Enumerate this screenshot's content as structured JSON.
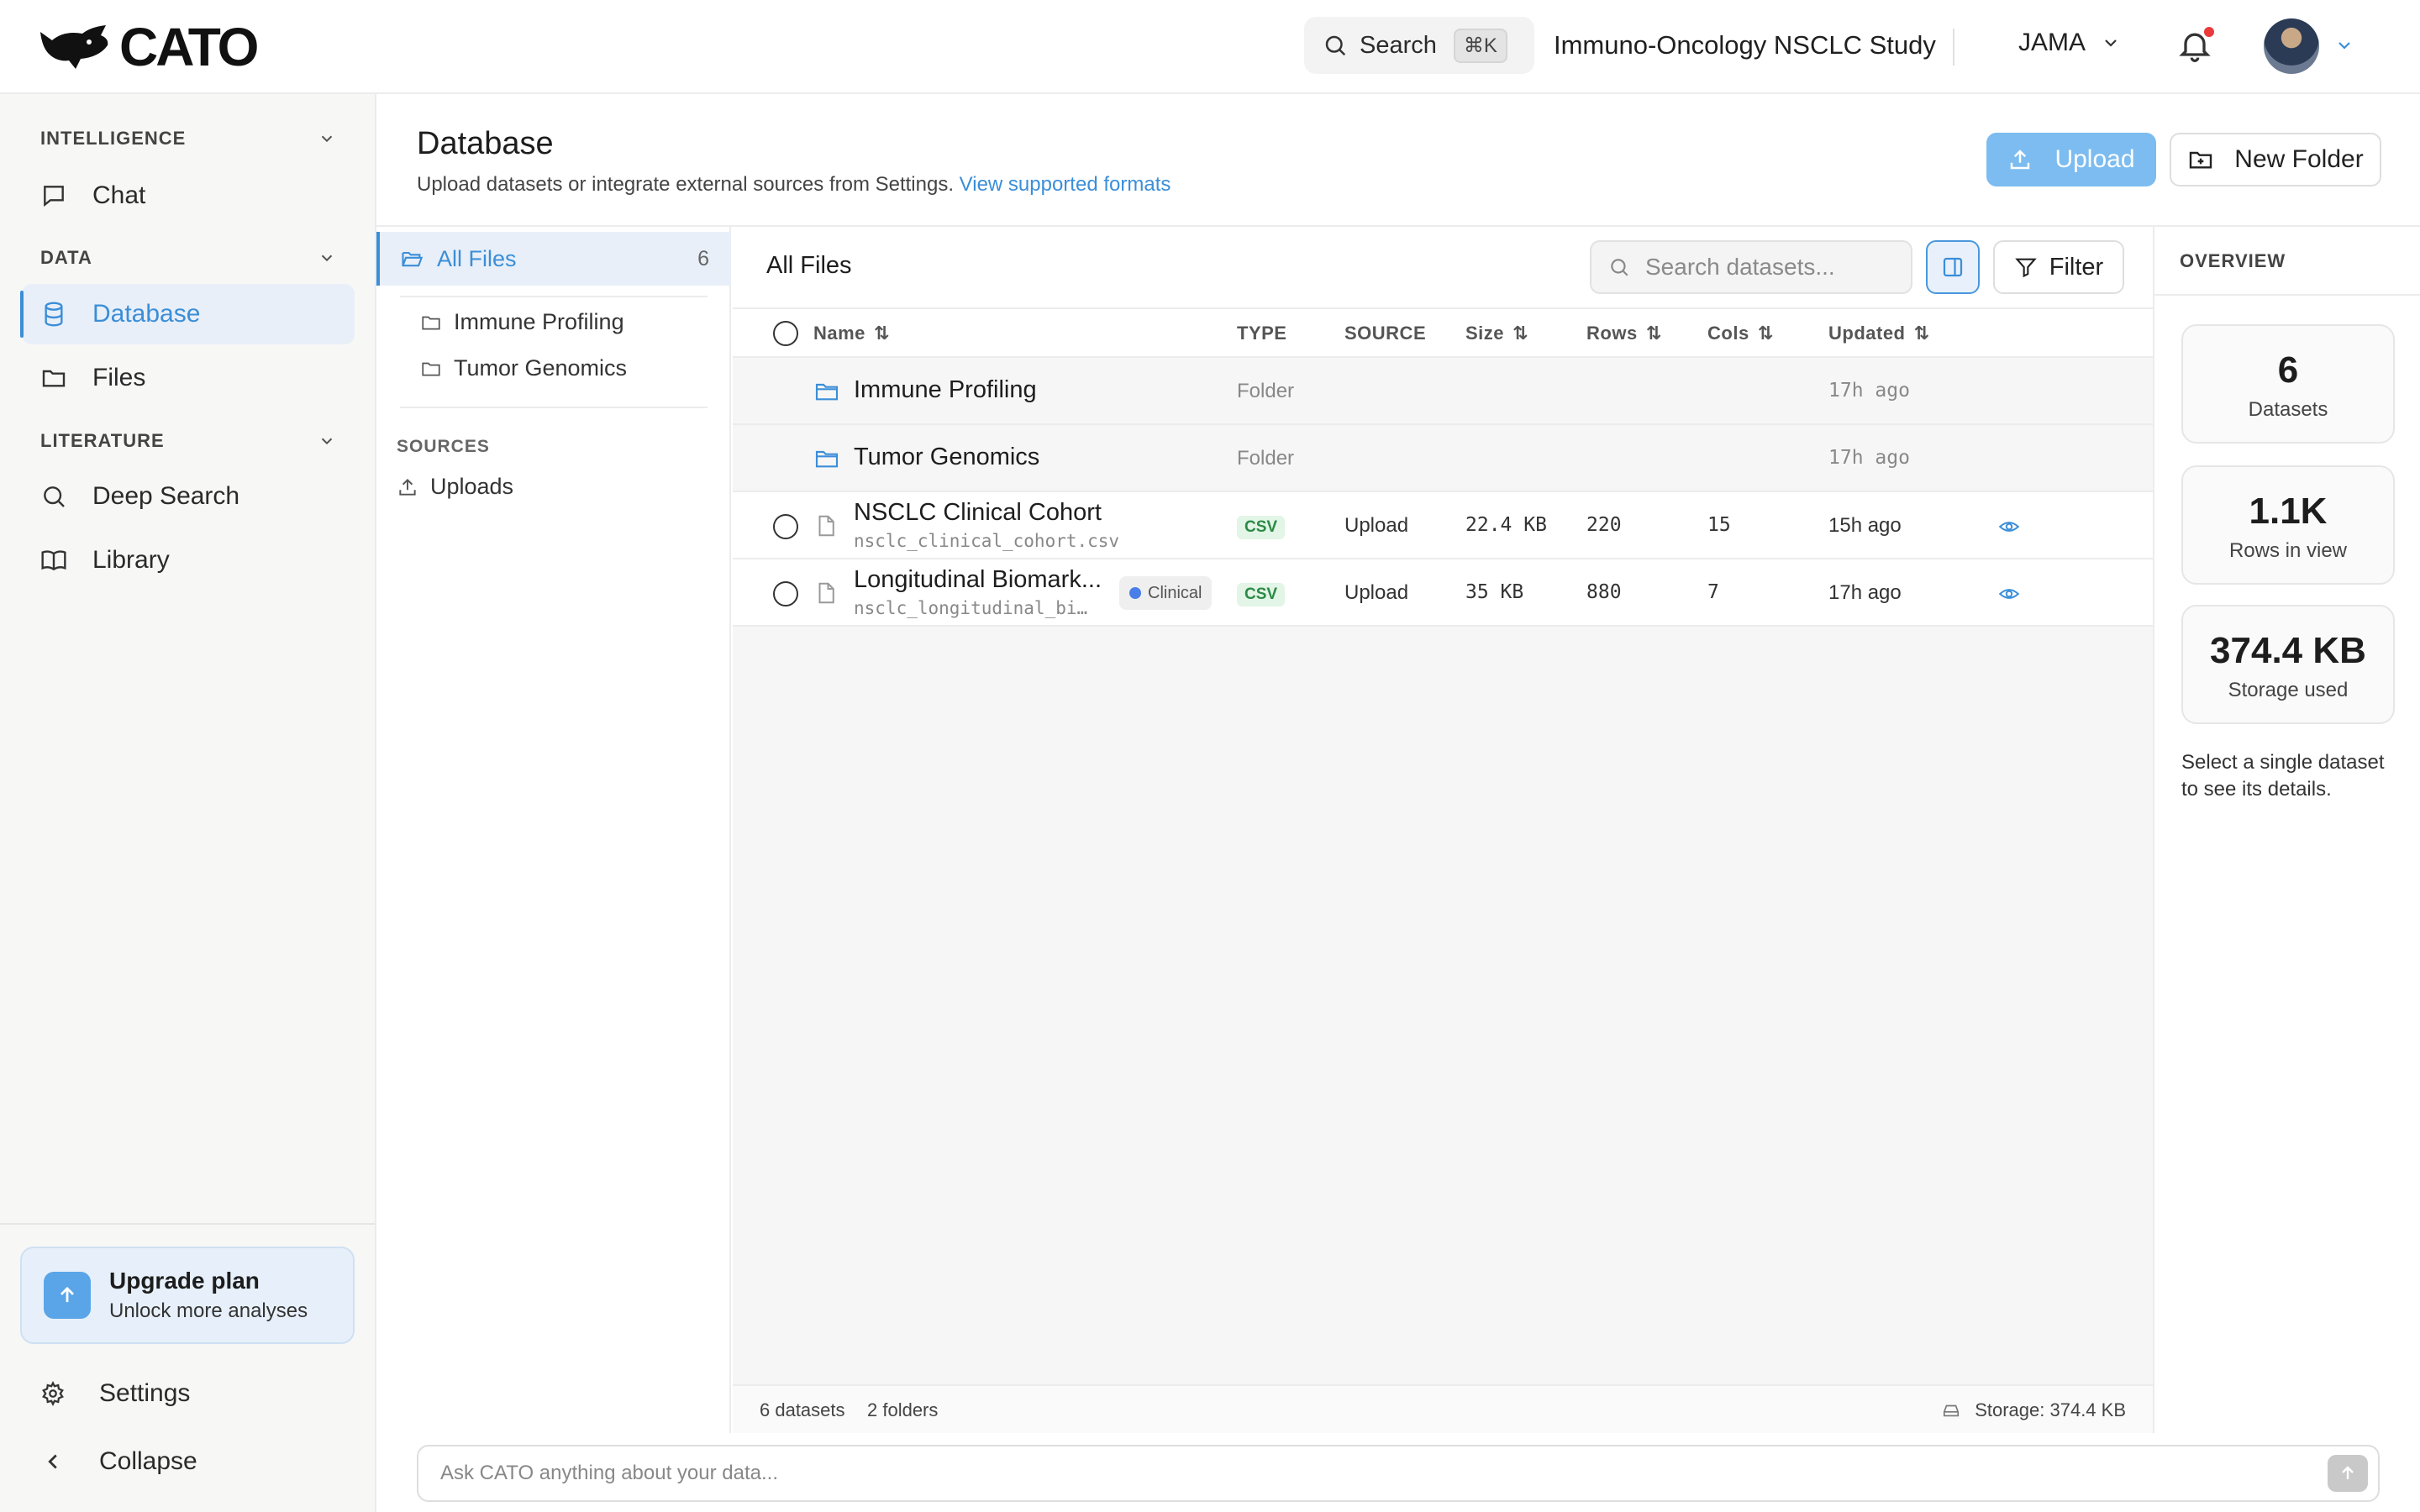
{
  "app": {
    "logo_text": "CATO"
  },
  "topbar": {
    "search_label": "Search",
    "search_shortcut": "⌘K",
    "study_name": "Immuno-Oncology NSCLC Study",
    "user_name": "JAMA",
    "notification_dot_color": "#ea3a3a"
  },
  "sidebar": {
    "sections": [
      {
        "label": "INTELLIGENCE",
        "items": [
          {
            "label": "Chat",
            "icon": "chat-icon"
          }
        ]
      },
      {
        "label": "DATA",
        "items": [
          {
            "label": "Database",
            "icon": "database-icon",
            "active": true
          },
          {
            "label": "Files",
            "icon": "folder-icon"
          }
        ]
      },
      {
        "label": "LITERATURE",
        "items": [
          {
            "label": "Deep Search",
            "icon": "search-icon"
          },
          {
            "label": "Library",
            "icon": "book-icon"
          }
        ]
      }
    ],
    "upgrade": {
      "title": "Upgrade plan",
      "subtitle": "Unlock more analyses"
    },
    "settings_label": "Settings",
    "collapse_label": "Collapse"
  },
  "page": {
    "title": "Database",
    "subtitle": "Upload datasets or integrate external sources from Settings.",
    "formats_link": "View supported formats",
    "upload_label": "Upload",
    "new_folder_label": "New Folder",
    "accent_color": "#3b8ed8"
  },
  "tree": {
    "all_files_label": "All Files",
    "all_files_count": "6",
    "folders": [
      "Immune Profiling",
      "Tumor Genomics"
    ],
    "sources_label": "SOURCES",
    "sources": [
      "Uploads"
    ]
  },
  "list": {
    "title": "All Files",
    "search_placeholder": "Search datasets...",
    "filter_label": "Filter",
    "columns": {
      "name": "Name",
      "type": "TYPE",
      "source": "SOURCE",
      "size": "Size",
      "rows": "Rows",
      "cols": "Cols",
      "updated": "Updated"
    },
    "rows": [
      {
        "kind": "folder",
        "name": "Immune Profiling",
        "type": "Folder",
        "updated": "17h ago"
      },
      {
        "kind": "folder",
        "name": "Tumor Genomics",
        "type": "Folder",
        "updated": "17h ago"
      },
      {
        "kind": "file",
        "name": "NSCLC Clinical Cohort",
        "filename": "nsclc_clinical_cohort.csv",
        "type": "CSV",
        "source": "Upload",
        "size": "22.4 KB",
        "rows": "220",
        "cols": "15",
        "updated": "15h ago"
      },
      {
        "kind": "file",
        "name": "Longitudinal Biomark...",
        "filename": "nsclc_longitudinal_bi…",
        "tag": "Clinical",
        "type": "CSV",
        "source": "Upload",
        "size": "35 KB",
        "rows": "880",
        "cols": "7",
        "updated": "17h ago"
      }
    ],
    "footer": {
      "datasets": "6 datasets",
      "folders": "2 folders",
      "storage": "Storage: 374.4 KB"
    }
  },
  "overview": {
    "title": "OVERVIEW",
    "cards": [
      {
        "value": "6",
        "label": "Datasets"
      },
      {
        "value": "1.1K",
        "label": "Rows in view"
      },
      {
        "value": "374.4 KB",
        "label": "Storage used"
      }
    ],
    "note": "Select a single dataset to see its details."
  },
  "chat": {
    "placeholder": "Ask CATO anything about your data..."
  }
}
